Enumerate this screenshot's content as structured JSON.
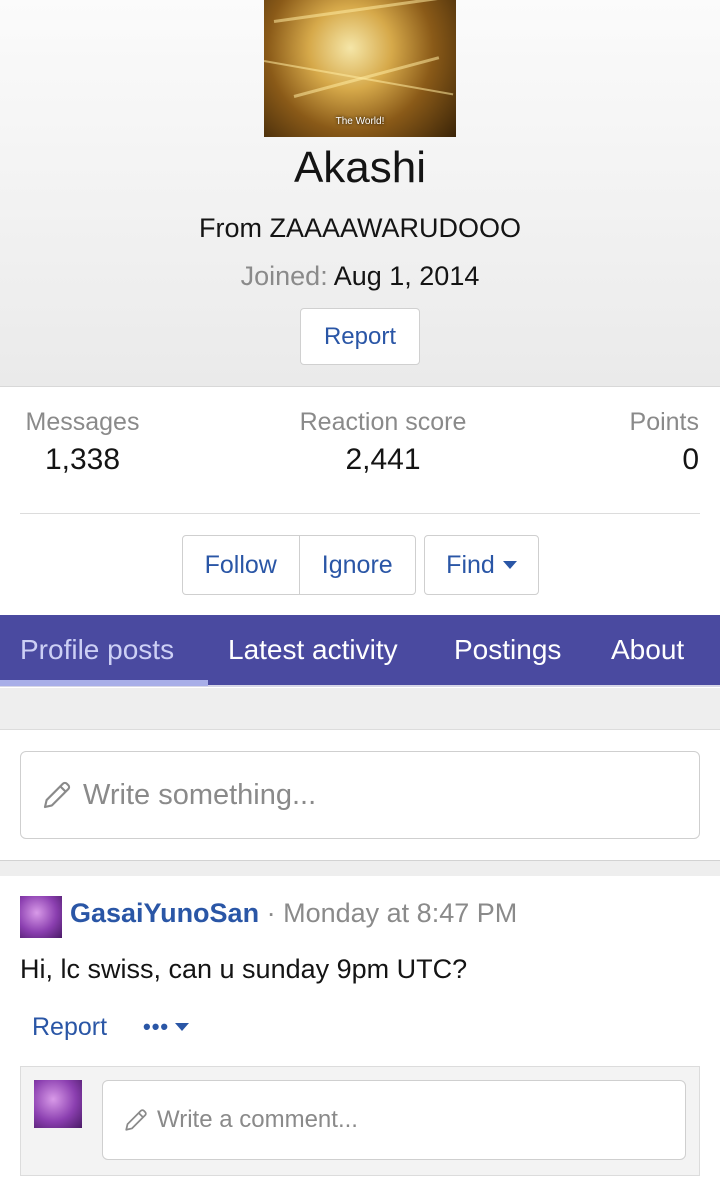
{
  "profile": {
    "avatar_caption": "The World!",
    "username": "Akashi",
    "location": "From ZAAAAWARUDOOO",
    "joined_label": "Joined:",
    "joined_date": "Aug 1, 2014",
    "report_label": "Report"
  },
  "stats": {
    "messages_label": "Messages",
    "messages_value": "1,338",
    "reaction_label": "Reaction score",
    "reaction_value": "2,441",
    "points_label": "Points",
    "points_value": "0"
  },
  "actions": {
    "follow": "Follow",
    "ignore": "Ignore",
    "find": "Find"
  },
  "tabs": [
    {
      "label": "Profile posts",
      "active": true
    },
    {
      "label": "Latest activity",
      "active": false
    },
    {
      "label": "Postings",
      "active": false
    },
    {
      "label": "About",
      "active": false
    }
  ],
  "composer": {
    "placeholder": "Write something..."
  },
  "post": {
    "author": "GasaiYunoSan",
    "separator": "·",
    "time": "Monday at 8:47 PM",
    "body": "Hi, lc swiss, can u sunday 9pm UTC?",
    "report_label": "Report",
    "more_label": "•••",
    "comment_placeholder": "Write a comment..."
  },
  "colors": {
    "accent": "#2a56a6",
    "tabbar": "#4a4aa0",
    "muted": "#8a8a8a"
  }
}
